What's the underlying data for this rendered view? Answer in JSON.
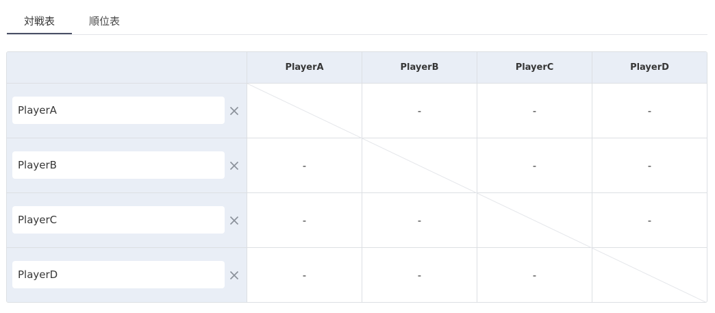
{
  "tabs": [
    {
      "label": "対戦表",
      "active": true
    },
    {
      "label": "順位表",
      "active": false
    }
  ],
  "players": [
    "PlayerA",
    "PlayerB",
    "PlayerC",
    "PlayerD"
  ],
  "result_placeholder": "-",
  "icons": {
    "remove": "close-icon"
  },
  "colors": {
    "header_bg": "#e9eef6",
    "border": "#dcdfe3",
    "tab_underline": "#4a5066"
  }
}
